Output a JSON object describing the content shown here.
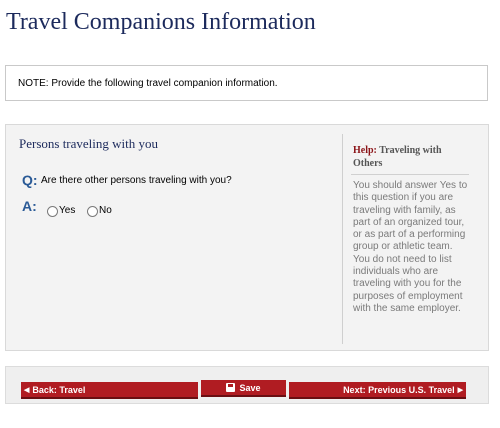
{
  "page_title": "Travel Companions Information",
  "note": "NOTE: Provide the following travel companion information.",
  "section": {
    "title": "Persons traveling with you",
    "question_marker": "Q:",
    "question": "Are there other persons traveling with you?",
    "answer_marker": "A:",
    "options": [
      {
        "label": "Yes",
        "selected": false
      },
      {
        "label": "No",
        "selected": false
      }
    ]
  },
  "help": {
    "label": "Help:",
    "title": "Traveling with Others",
    "text": "You should answer Yes to this question if you are traveling with family, as part of an organized tour, or as part of a performing group or athletic team. You do not need to list individuals who are traveling with you for the purposes of employment with the same employer."
  },
  "nav": {
    "back_label": "Back: Travel",
    "save_label": "Save",
    "next_label": "Next: Previous U.S. Travel",
    "button_color": "#b01c22"
  }
}
